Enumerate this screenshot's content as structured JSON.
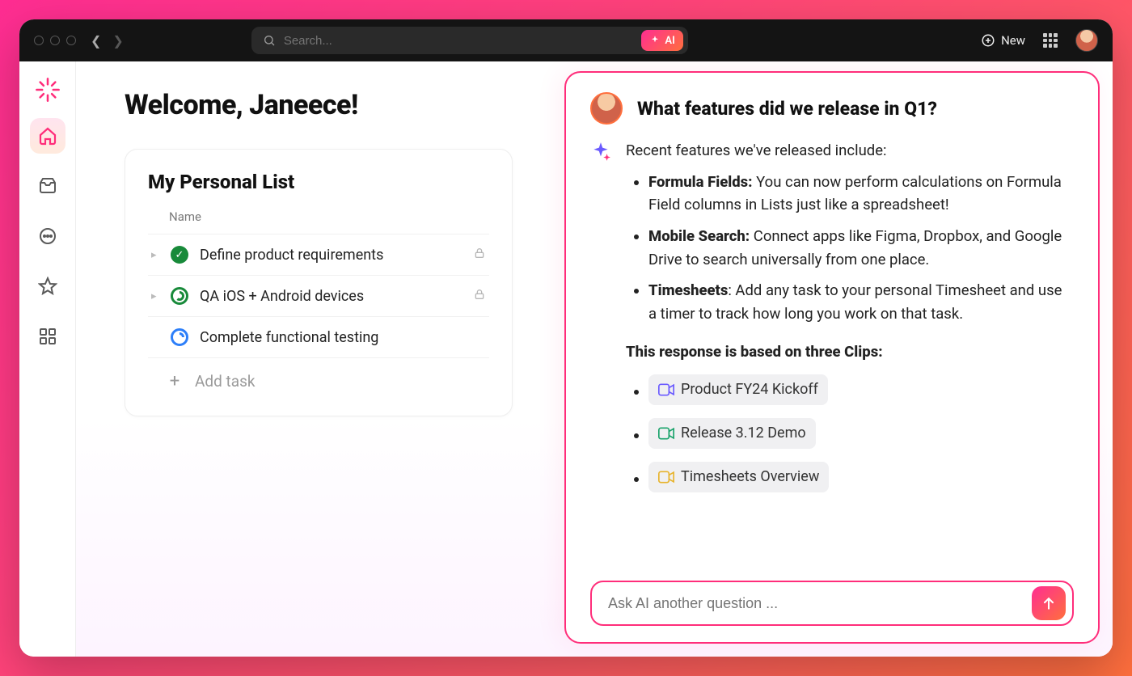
{
  "titlebar": {
    "search_placeholder": "Search...",
    "ai_badge": "AI",
    "new_label": "New"
  },
  "sidebar": {
    "items": [
      {
        "name": "home",
        "active": true
      },
      {
        "name": "inbox",
        "active": false
      },
      {
        "name": "more",
        "active": false
      },
      {
        "name": "favorites",
        "active": false
      },
      {
        "name": "apps",
        "active": false
      }
    ]
  },
  "main": {
    "welcome": "Welcome, Janeece!",
    "list_title": "My Personal List",
    "column_header": "Name",
    "tasks": [
      {
        "title": "Define product requirements",
        "status": "done",
        "locked": true,
        "expandable": true
      },
      {
        "title": "QA iOS + Android devices",
        "status": "progress",
        "locked": true,
        "expandable": true
      },
      {
        "title": "Complete functional testing",
        "status": "open",
        "locked": false,
        "expandable": false
      }
    ],
    "add_task_label": "Add task"
  },
  "ai": {
    "question": "What features did we release in Q1?",
    "answer_intro": "Recent features we've released include:",
    "features": [
      {
        "name": "Formula Fields:",
        "desc": " You can now perform calculations on Formula Field columns in Lists just like a spreadsheet!"
      },
      {
        "name": "Mobile Search:",
        "desc": " Connect apps like Figma, Dropbox, and Google Drive to search universally from one place."
      },
      {
        "name": "Timesheets",
        "desc": ": Add any task to your personal Timesheet and use a timer to track how long you work on that task."
      }
    ],
    "clips_heading": "This response is based on three Clips:",
    "clips": [
      {
        "label": "Product FY24 Kickoff",
        "color": "#6b5bff"
      },
      {
        "label": "Release 3.12 Demo",
        "color": "#1aa36b"
      },
      {
        "label": "Timesheets Overview",
        "color": "#e7b42e"
      }
    ],
    "input_placeholder": "Ask AI another question ..."
  }
}
